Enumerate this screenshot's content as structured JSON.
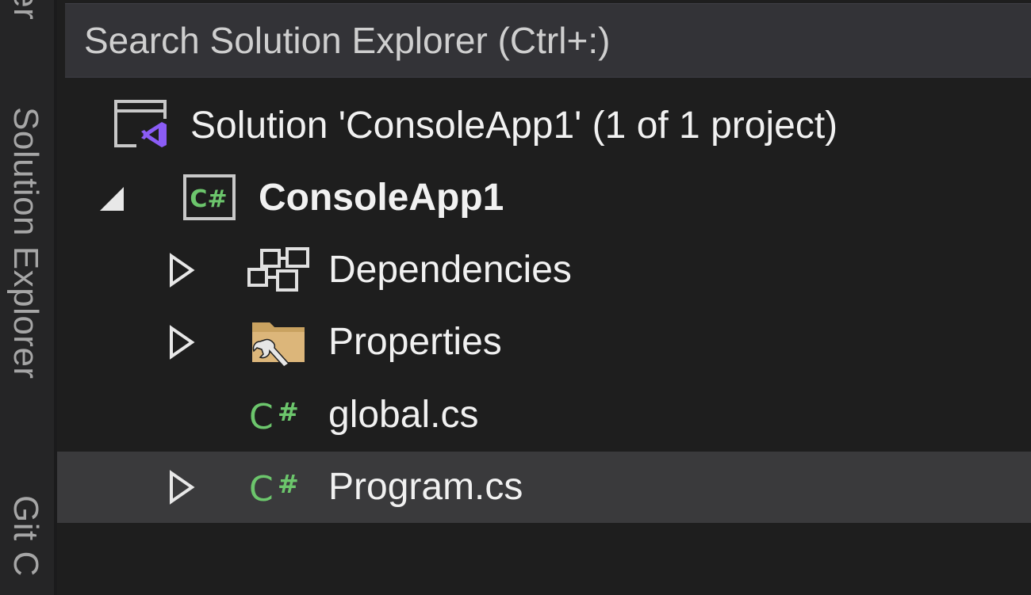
{
  "side_tabs": {
    "explorer_partial": "erer",
    "solution_explorer": "Solution Explorer",
    "git_partial": "Git C"
  },
  "search": {
    "placeholder": "Search Solution Explorer (Ctrl+:)",
    "value": ""
  },
  "tree": {
    "solution": {
      "label": "Solution 'ConsoleApp1' (1 of 1 project)",
      "icon": "solution-icon"
    },
    "project": {
      "label": "ConsoleApp1",
      "icon": "csharp-project-icon",
      "expanded": true
    },
    "items": [
      {
        "label": "Dependencies",
        "icon": "dependencies-icon",
        "expandable": true,
        "selected": false
      },
      {
        "label": "Properties",
        "icon": "properties-folder-icon",
        "expandable": true,
        "selected": false
      },
      {
        "label": "global.cs",
        "icon": "csharp-file-icon",
        "expandable": false,
        "selected": false
      },
      {
        "label": "Program.cs",
        "icon": "csharp-file-icon",
        "expandable": true,
        "selected": true
      }
    ]
  },
  "colors": {
    "background": "#1e1e1e",
    "side_strip": "#252526",
    "search_bg": "#333337",
    "selected_row": "#3a3a3c",
    "text": "#f1f1f1",
    "csharp_green": "#6cc66c",
    "vs_purple": "#8b5cf6",
    "folder_tan": "#dcb67a"
  }
}
